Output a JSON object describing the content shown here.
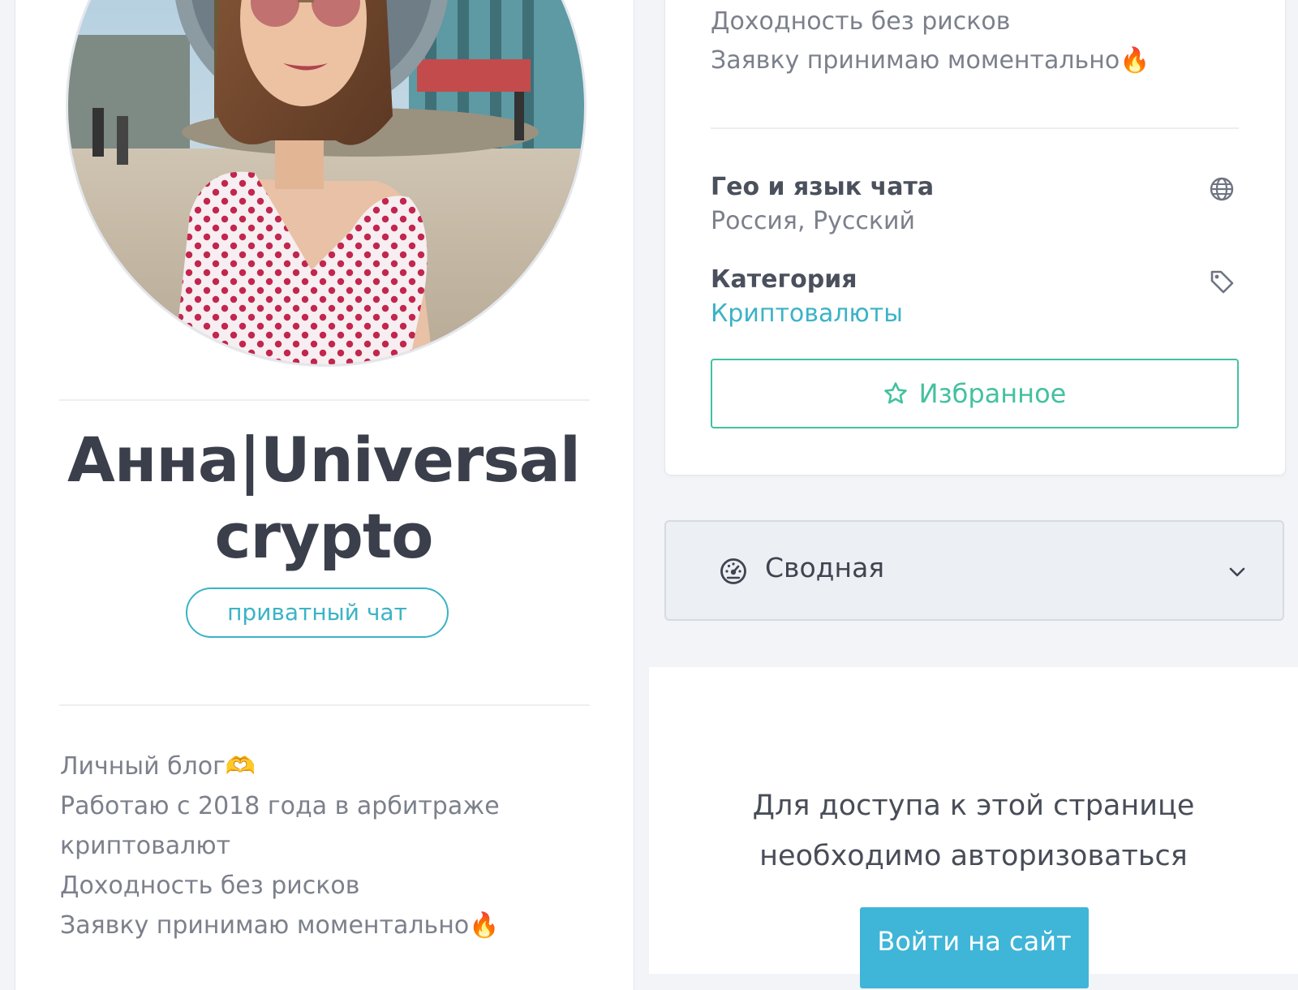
{
  "profile": {
    "name_line1": "Анна|Universal",
    "name_line2": "crypto",
    "chat_type_badge": "приватный чат",
    "bio_lines": [
      "Личный блог🫶",
      "Работаю с 2018 года в арбитраже",
      "криптовалют",
      "Доходность без рисков",
      "Заявку принимаю моментально🔥"
    ]
  },
  "info": {
    "description_lines": [
      "Доходность без рисков",
      "Заявку принимаю моментально🔥"
    ],
    "geo_title": "Гео и язык чата",
    "geo_value": "Россия, Русский",
    "category_title": "Категория",
    "category_value": "Криптовалюты",
    "favorite_label": "Избранное",
    "icons": {
      "geo": "globe-icon",
      "category": "tag-icon",
      "favorite": "star-icon"
    }
  },
  "summary": {
    "label": "Сводная",
    "icon": "dashboard-gauge-icon",
    "toggle_icon": "chevron-down-icon"
  },
  "auth": {
    "message_line1": "Для доступа к этой странице",
    "message_line2": "необходимо авторизоваться",
    "login_label": "Войти на сайт"
  },
  "colors": {
    "accent_teal": "#3ab3c6",
    "favorite_green": "#43c1a0",
    "login_blue": "#3fb5d8",
    "text_dark": "#3a3f4b",
    "text_muted": "#7b808b"
  }
}
